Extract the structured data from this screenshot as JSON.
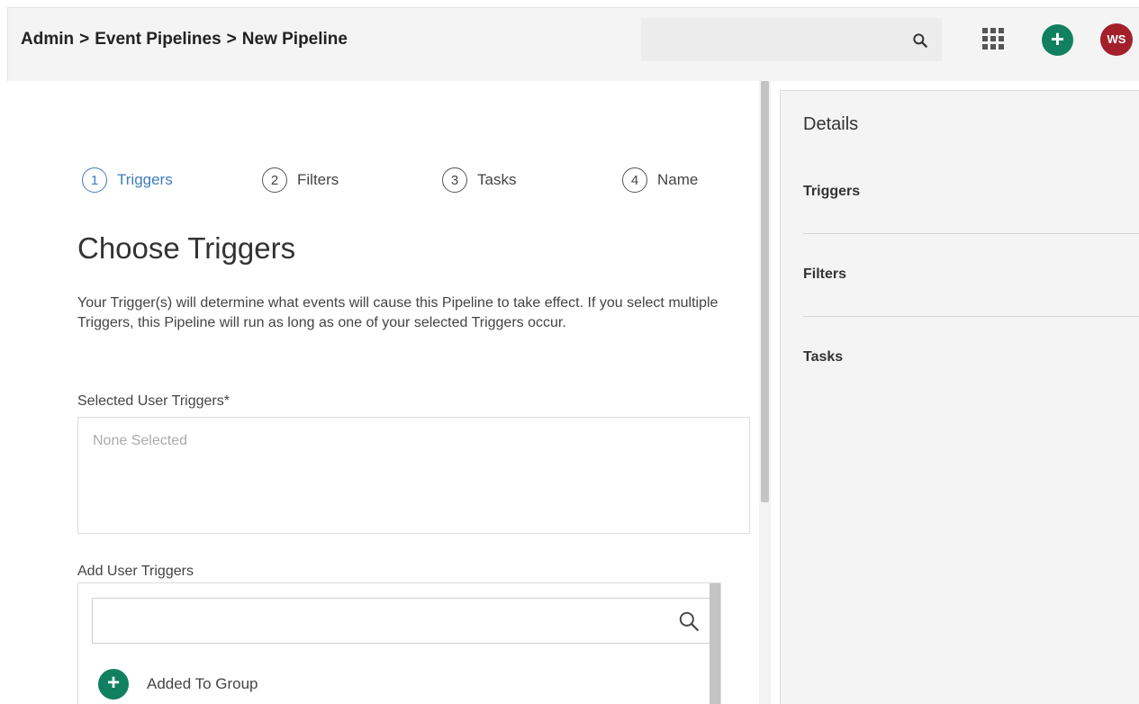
{
  "header": {
    "breadcrumb": [
      "Admin",
      "Event Pipelines",
      "New Pipeline"
    ],
    "search_placeholder": "",
    "avatar_initials": "WS",
    "add_label": "+"
  },
  "steps": [
    {
      "num": "1",
      "label": "Triggers",
      "active": true
    },
    {
      "num": "2",
      "label": "Filters",
      "active": false
    },
    {
      "num": "3",
      "label": "Tasks",
      "active": false
    },
    {
      "num": "4",
      "label": "Name",
      "active": false
    }
  ],
  "content": {
    "title": "Choose Triggers",
    "description": "Your Trigger(s) will determine what events will cause this Pipeline to take effect. If you select multiple Triggers, this Pipeline will run as long as one of your selected Triggers occur.",
    "selected_label": "Selected User Triggers*",
    "selected_placeholder": "None Selected",
    "add_label": "Add User Triggers",
    "add_search_value": "",
    "trigger_items": [
      "Added To Group"
    ]
  },
  "details": {
    "heading": "Details",
    "sections": [
      "Triggers",
      "Filters",
      "Tasks"
    ]
  },
  "colors": {
    "accent_green": "#118060",
    "active_blue": "#3d7dbf",
    "avatar_red": "#a3202b"
  },
  "icons": {
    "search": "search-icon",
    "apps": "apps-grid-icon",
    "add": "plus-icon"
  }
}
